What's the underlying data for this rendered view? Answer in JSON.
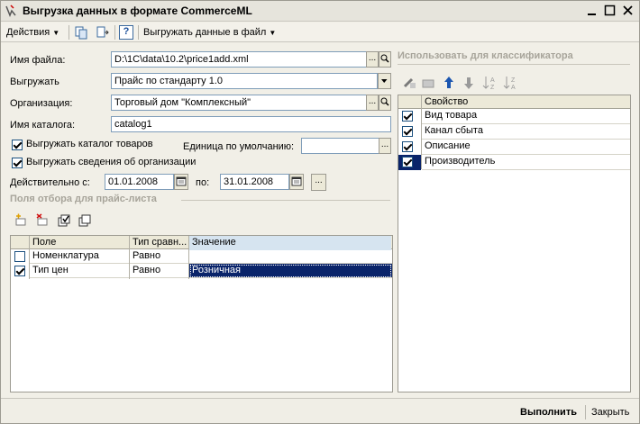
{
  "window": {
    "title": "Выгрузка данных в формате CommerceML"
  },
  "toolbar": {
    "actions_label": "Действия",
    "help_label": "?",
    "export_label": "Выгружать данные в файл"
  },
  "form": {
    "file_label": "Имя файла:",
    "file_value": "D:\\1C\\data\\10.2\\price1add.xml",
    "export_label": "Выгружать",
    "export_value": "Прайс по стандарту 1.0",
    "org_label": "Организация:",
    "org_value": "Торговый дом \"Комплексный\"",
    "catalog_label": "Имя каталога:",
    "catalog_value": "catalog1",
    "export_catalog_label": "Выгружать каталог товаров",
    "export_catalog_checked": true,
    "unit_label": "Единица по умолчанию:",
    "unit_value": "",
    "export_org_label": "Выгружать сведения об организации",
    "export_org_checked": true,
    "valid_from_label": "Действительно с:",
    "valid_from_value": "01.01.2008",
    "valid_to_label": "по:",
    "valid_to_value": "31.01.2008",
    "ellipsis": "..."
  },
  "filter_section": {
    "title": "Поля отбора для прайс-листа",
    "columns": [
      "Поле",
      "Тип сравн...",
      "Значение"
    ],
    "rows": [
      {
        "checked": false,
        "field": "Номенклатура",
        "compare": "Равно",
        "value": ""
      },
      {
        "checked": true,
        "field": "Тип цен",
        "compare": "Равно",
        "value": "Розничная"
      }
    ]
  },
  "classifier_section": {
    "title": "Использовать для классификатора",
    "column": "Свойство",
    "rows": [
      {
        "checked": true,
        "label": "Вид товара"
      },
      {
        "checked": true,
        "label": "Канал сбыта"
      },
      {
        "checked": true,
        "label": "Описание"
      },
      {
        "checked": true,
        "label": "Производитель"
      }
    ]
  },
  "buttons": {
    "run_label": "Выполнить",
    "close_label": "Закрыть"
  },
  "colors": {
    "selection": "#0a246a",
    "section_text": "#a7a49a"
  }
}
